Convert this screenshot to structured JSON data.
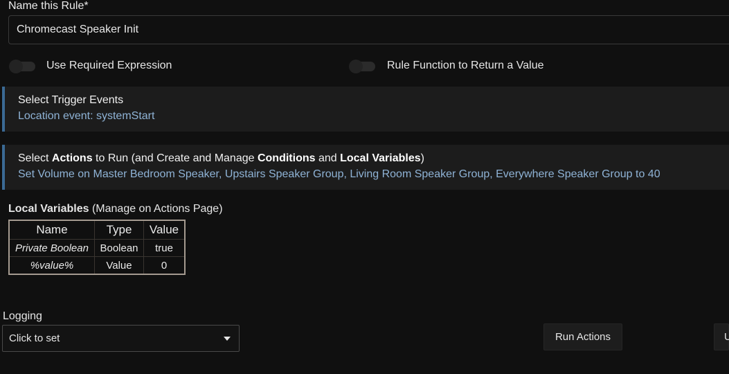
{
  "rule_name": {
    "label": "Name this Rule*",
    "value": "Chromecast Speaker Init"
  },
  "toggles": [
    {
      "label": "Use Required Expression",
      "on": false
    },
    {
      "label": "Rule Function to Return a Value",
      "on": false
    }
  ],
  "triggers": {
    "title": "Select Trigger Events",
    "summary": "Location event: systemStart"
  },
  "actions": {
    "title_prefix": "Select ",
    "title_actions": "Actions",
    "title_mid1": " to Run (and Create and Manage ",
    "title_conditions": "Conditions",
    "title_mid2": " and ",
    "title_local_vars": "Local Variables",
    "title_suffix": ")",
    "summary": "Set Volume on Master Bedroom Speaker, Upstairs Speaker Group, Living Room Speaker Group, Everywhere Speaker Group to 40"
  },
  "local_variables": {
    "heading": "Local Variables",
    "heading_note": " (Manage on Actions Page)",
    "columns": [
      "Name",
      "Type",
      "Value"
    ],
    "rows": [
      {
        "name": "Private Boolean",
        "type": "Boolean",
        "value": "true"
      },
      {
        "name": "%value%",
        "type": "Value",
        "value": "0"
      }
    ]
  },
  "logging": {
    "label": "Logging",
    "selected": "Click to set"
  },
  "buttons": {
    "run_actions": "Run Actions",
    "partial": "U"
  },
  "colors": {
    "background": "#101010",
    "panel": "#1c1c1c",
    "accent_bar": "#3b6a95",
    "link_text": "#8fb3d6",
    "table_border": "#a59b90"
  }
}
